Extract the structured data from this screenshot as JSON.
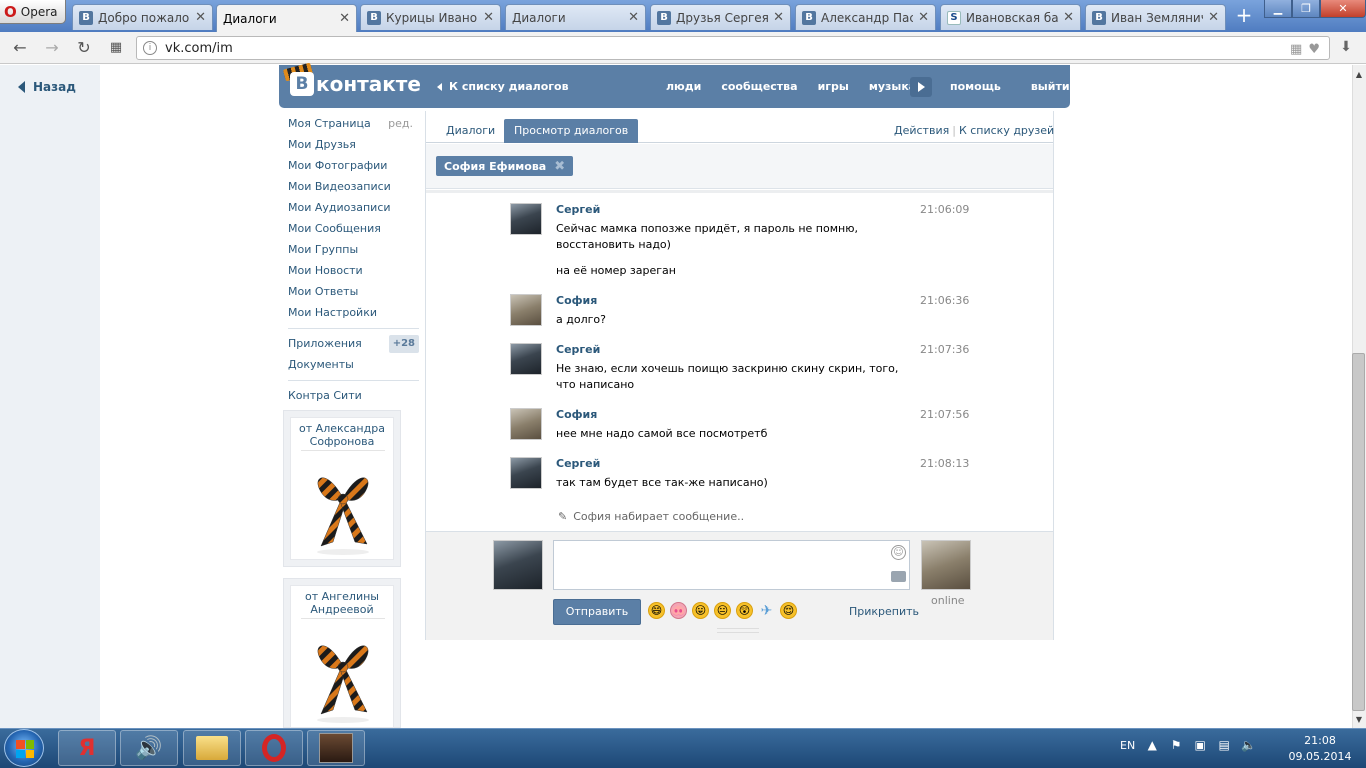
{
  "browser": {
    "menu_label": "Opera",
    "tabs": [
      {
        "label": "Добро пожаловать",
        "icon": "vk-icon",
        "active": false
      },
      {
        "label": "Диалоги",
        "icon": "message-icon",
        "active": true
      },
      {
        "label": "Курицы Ивановы",
        "icon": "vk-icon",
        "active": false
      },
      {
        "label": "Диалоги",
        "icon": "message-icon",
        "active": false
      },
      {
        "label": "Друзья Сергея К",
        "icon": "vk-icon",
        "active": false
      },
      {
        "label": "Александр Пасе",
        "icon": "vk-icon",
        "active": false
      },
      {
        "label": "Ивановская бар",
        "icon": "site-icon",
        "active": false
      },
      {
        "label": "Иван Землянич",
        "icon": "vk-icon",
        "active": false
      }
    ],
    "tab_close": "✕",
    "new_tab": "+",
    "url": "vk.com/im"
  },
  "sidebar_back": "Назад",
  "vk_header": {
    "logo": "контакте",
    "logo_letter": "В",
    "back_to_list": "К списку диалогов",
    "nav": [
      "люди",
      "сообщества",
      "игры",
      "музыка"
    ],
    "nav2": [
      "помощь",
      "выйти"
    ]
  },
  "left_menu": {
    "items": [
      "Моя Страница",
      "Мои Друзья",
      "Мои Фотографии",
      "Мои Видеозаписи",
      "Мои Аудиозаписи",
      "Мои Сообщения",
      "Мои Группы",
      "Мои Новости",
      "Мои Ответы",
      "Мои Настройки"
    ],
    "edit": "ред.",
    "apps": "Приложения",
    "apps_count": "+28",
    "docs": "Документы",
    "game": "Контра Сити"
  },
  "gifts": [
    {
      "from": "от Александра Софронова"
    },
    {
      "from": "от Ангелины Андреевой"
    }
  ],
  "dialog": {
    "tab_dialogs": "Диалоги",
    "tab_view": "Просмотр диалогов",
    "actions": "Действия",
    "to_friends": "К списку друзей",
    "peer": "София Ефимова",
    "messages": [
      {
        "name": "Сергей",
        "time": "21:06:09",
        "text": "Сейчас мамка попозже придёт, я пароль не помню, восстановить надо)",
        "text2": "на её номер зареган",
        "who": "sergey"
      },
      {
        "name": "София",
        "time": "21:06:36",
        "text": "а долго?",
        "who": "sofia"
      },
      {
        "name": "Сергей",
        "time": "21:07:36",
        "text": "Не знаю, если хочешь поищю заскриню скину скрин, того, что написано",
        "who": "sergey"
      },
      {
        "name": "София",
        "time": "21:07:56",
        "text": "нее мне надо самой все посмотретб",
        "who": "sofia"
      },
      {
        "name": "Сергей",
        "time": "21:08:13",
        "text": "так там будет все так-же написано)",
        "who": "sergey"
      }
    ],
    "typing": "София набирает сообщение..",
    "send": "Отправить",
    "attach": "Прикрепить",
    "online": "online"
  },
  "taskbar": {
    "lang": "EN",
    "time": "21:08",
    "date": "09.05.2014"
  }
}
